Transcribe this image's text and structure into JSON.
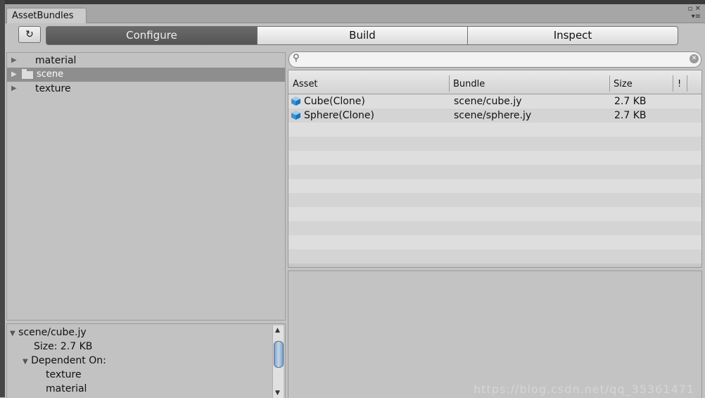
{
  "window": {
    "tab_title": "AssetBundles",
    "icons": [
      "maximize-icon",
      "close-icon",
      "menu-icon"
    ]
  },
  "toolbar": {
    "refresh_icon": "refresh-icon",
    "modes": [
      {
        "label": "Configure",
        "active": true
      },
      {
        "label": "Build",
        "active": false
      },
      {
        "label": "Inspect",
        "active": false
      }
    ]
  },
  "bundle_tree": {
    "items": [
      {
        "label": "material",
        "selected": false
      },
      {
        "label": "scene",
        "selected": true,
        "icon": "folder-icon"
      },
      {
        "label": "texture",
        "selected": false
      }
    ]
  },
  "details": {
    "bundle_name": "scene/cube.jy",
    "size_line": "Size: 2.7 KB",
    "dependent_header": "Dependent On:",
    "dependencies": [
      "texture",
      "material"
    ]
  },
  "search": {
    "value": "",
    "placeholder": ""
  },
  "asset_table": {
    "columns": {
      "asset": "Asset",
      "bundle": "Bundle",
      "size": "Size",
      "flag": "!"
    },
    "rows": [
      {
        "asset": "Cube(Clone)",
        "bundle": "scene/cube.jy",
        "size": "2.7 KB"
      },
      {
        "asset": "Sphere(Clone)",
        "bundle": "scene/sphere.jy",
        "size": "2.7 KB"
      }
    ]
  },
  "watermark": "https://blog.csdn.net/qq_35361471",
  "colors": {
    "selected_row": "#8e8e8e",
    "active_tab": "#5e5e5e",
    "asset_icon": "#4a9bd6"
  }
}
